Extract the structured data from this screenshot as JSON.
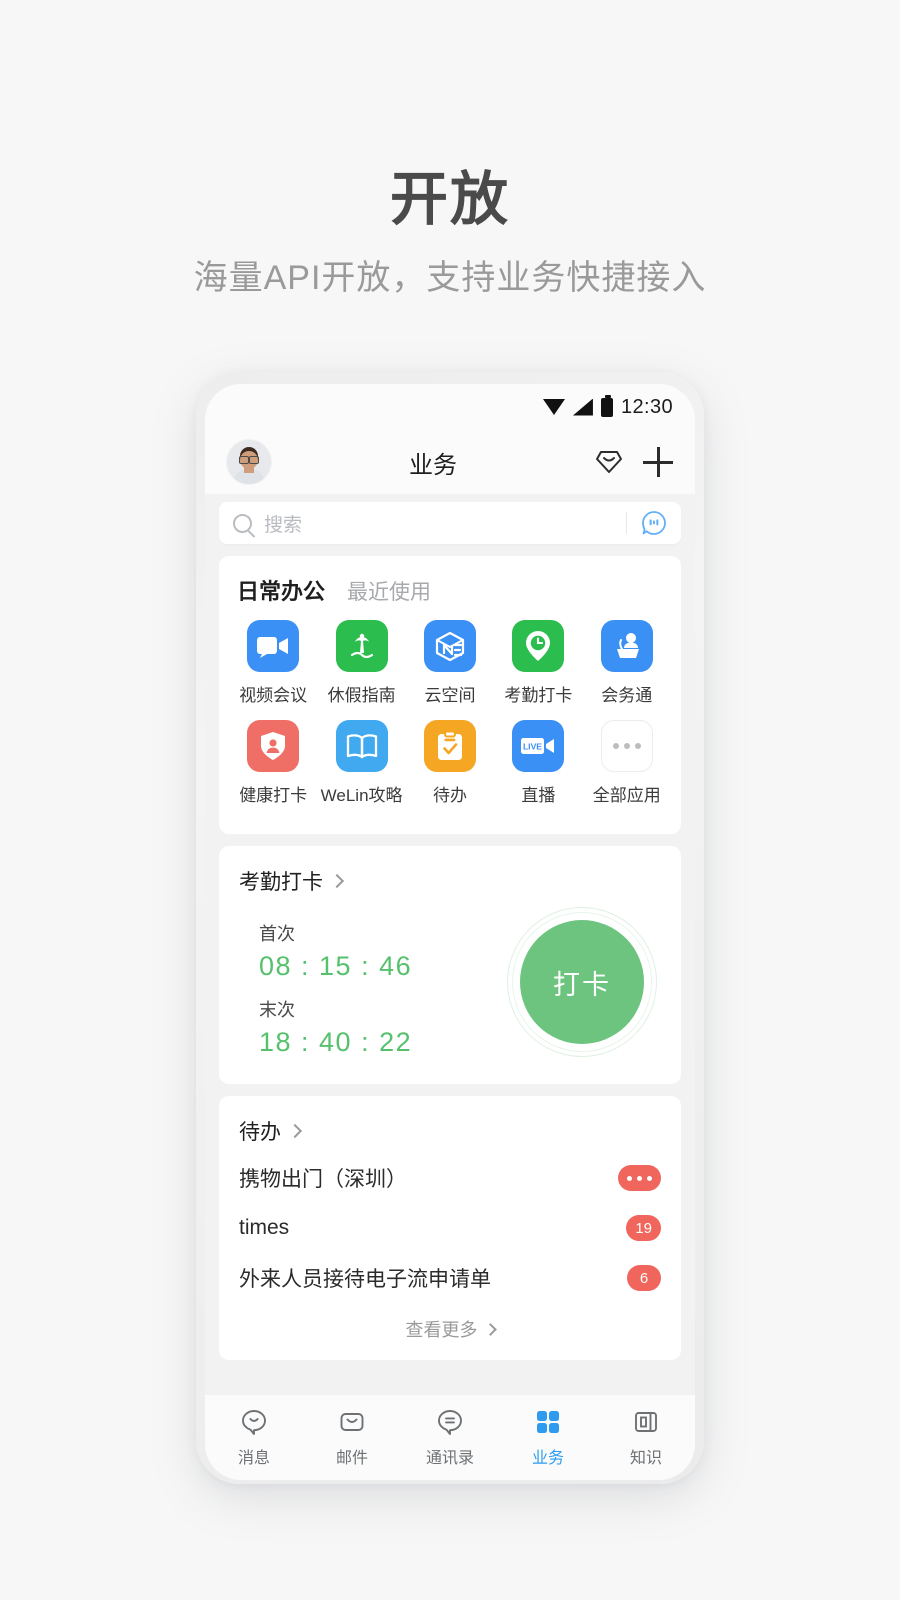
{
  "promo": {
    "headline": "开放",
    "subhead": "海量API开放，支持业务快捷接入"
  },
  "status_bar": {
    "time": "12:30",
    "icons": [
      "wifi-icon",
      "signal-icon",
      "battery-icon"
    ]
  },
  "header": {
    "title": "业务",
    "avatar_name": "user-avatar",
    "gem_icon": "diamond-icon",
    "add_icon": "plus-icon"
  },
  "search": {
    "placeholder": "搜索",
    "search_icon": "search-icon",
    "assistant_icon": "robot-face-icon"
  },
  "apps_section": {
    "tabs": [
      {
        "label": "日常办公",
        "active": true
      },
      {
        "label": "最近使用",
        "active": false
      }
    ],
    "apps": [
      {
        "label": "视频会议",
        "icon": "video-camera-icon",
        "color": "#3b90f5"
      },
      {
        "label": "休假指南",
        "icon": "palm-tree-icon",
        "color": "#2cbd4f"
      },
      {
        "label": "云空间",
        "icon": "ne-cube-icon",
        "color": "#3b90f5"
      },
      {
        "label": "考勤打卡",
        "icon": "location-clock-icon",
        "color": "#2cbd4f"
      },
      {
        "label": "会务通",
        "icon": "podium-speaker-icon",
        "color": "#3b90f5"
      },
      {
        "label": "健康打卡",
        "icon": "shield-person-icon",
        "color": "#ef6e66"
      },
      {
        "label": "WeLin攻略",
        "icon": "open-book-icon",
        "color": "#40a9f0"
      },
      {
        "label": "待办",
        "icon": "clipboard-check-icon",
        "color": "#f5a623"
      },
      {
        "label": "直播",
        "icon": "live-camera-icon",
        "color": "#3b90f5"
      },
      {
        "label": "全部应用",
        "icon": "more-dots-icon",
        "color": "#ffffff"
      }
    ]
  },
  "attendance": {
    "title": "考勤打卡",
    "chevron_icon": "chevron-right-icon",
    "first_label": "首次",
    "first_time": "08 : 15 : 46",
    "last_label": "末次",
    "last_time": "18 : 40 : 22",
    "punch_button": "打卡",
    "accent_color": "#56c16c"
  },
  "todo": {
    "title": "待办",
    "chevron_icon": "chevron-right-icon",
    "items": [
      {
        "text": "携物出门（深圳）",
        "badge": "···"
      },
      {
        "text": "times",
        "badge": "19"
      },
      {
        "text": "外来人员接待电子流申请单",
        "badge": "6"
      }
    ],
    "more_label": "查看更多",
    "badge_color": "#f0665c"
  },
  "bottom_nav": [
    {
      "label": "消息",
      "icon": "chat-bubble-icon",
      "active": false
    },
    {
      "label": "邮件",
      "icon": "mail-icon",
      "active": false
    },
    {
      "label": "通讯录",
      "icon": "contacts-icon",
      "active": false
    },
    {
      "label": "业务",
      "icon": "grid-apps-icon",
      "active": true
    },
    {
      "label": "知识",
      "icon": "book-knowledge-icon",
      "active": false
    }
  ]
}
